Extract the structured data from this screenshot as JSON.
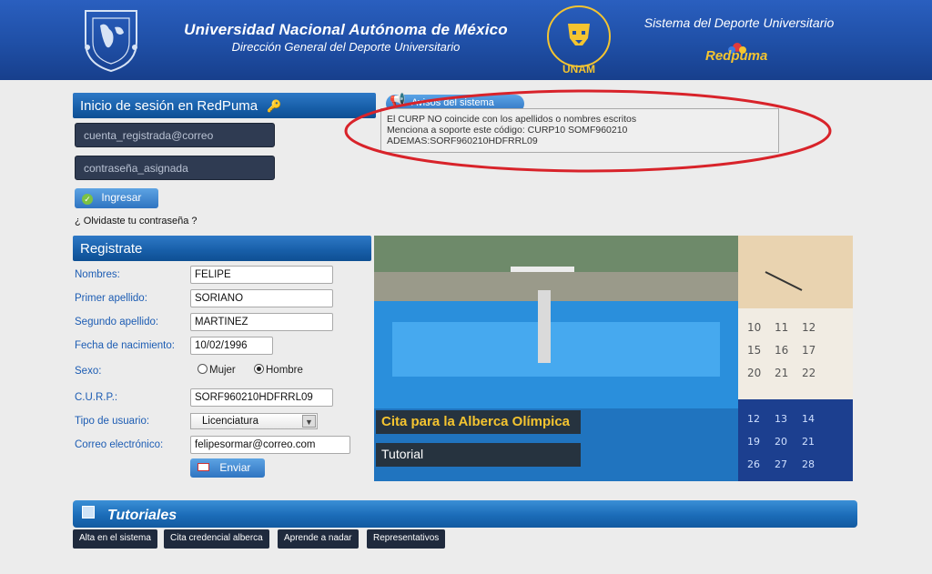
{
  "header": {
    "title": "Universidad Nacional Autónoma de México",
    "subtitle": "Dirección General del Deporte Universitario",
    "puma_logo_text": "UNAM",
    "sistema": "Sistema del Deporte Universitario",
    "redpuma_logo": "Redpuma"
  },
  "login": {
    "heading": "Inicio de sesión en RedPuma",
    "email_placeholder": "cuenta_registrada@correo",
    "password_placeholder": "contraseña_asignada",
    "submit_label": "Ingresar",
    "forgot_label": "¿ Olvidaste tu contraseña ?"
  },
  "avisos": {
    "heading": "Avisos del sistema",
    "lines": [
      "El CURP NO coincide con los apellidos o nombres escritos",
      "Menciona a soporte este código: CURP10 SOMF960210",
      "ADEMAS:SORF960210HDFRRL09"
    ]
  },
  "registro": {
    "heading": "Registrate",
    "fields": [
      {
        "label": "Nombres:",
        "value": "FELIPE"
      },
      {
        "label": "Primer apellido:",
        "value": "SORIANO"
      },
      {
        "label": "Segundo apellido:",
        "value": "MARTINEZ"
      },
      {
        "label": "Fecha de nacimiento:",
        "value": "10/02/1996"
      },
      {
        "label": "Sexo:",
        "value": "Hombre"
      },
      {
        "label": "C.U.R.P.:",
        "value": "SORF960210HDFRRL09"
      },
      {
        "label": "Tipo de usuario:",
        "value": "Licenciatura"
      },
      {
        "label": "Correo electrónico:",
        "value": "felipesormar@correo.com"
      }
    ],
    "sex_options": [
      "Mujer",
      "Hombre"
    ],
    "submit_label": "Enviar"
  },
  "banner": {
    "caption_main": "Cita para la Alberca Olímpica",
    "caption_sub": "Tutorial"
  },
  "tutoriales": {
    "heading": "Tutoriales",
    "buttons": [
      "Alta en el sistema",
      "Cita credencial alberca",
      "Aprende a nadar",
      "Representativos"
    ]
  },
  "colors": {
    "header_blue": "#1f4fa6",
    "accent_gold": "#f4c430",
    "annotation_red": "#d8232a"
  }
}
